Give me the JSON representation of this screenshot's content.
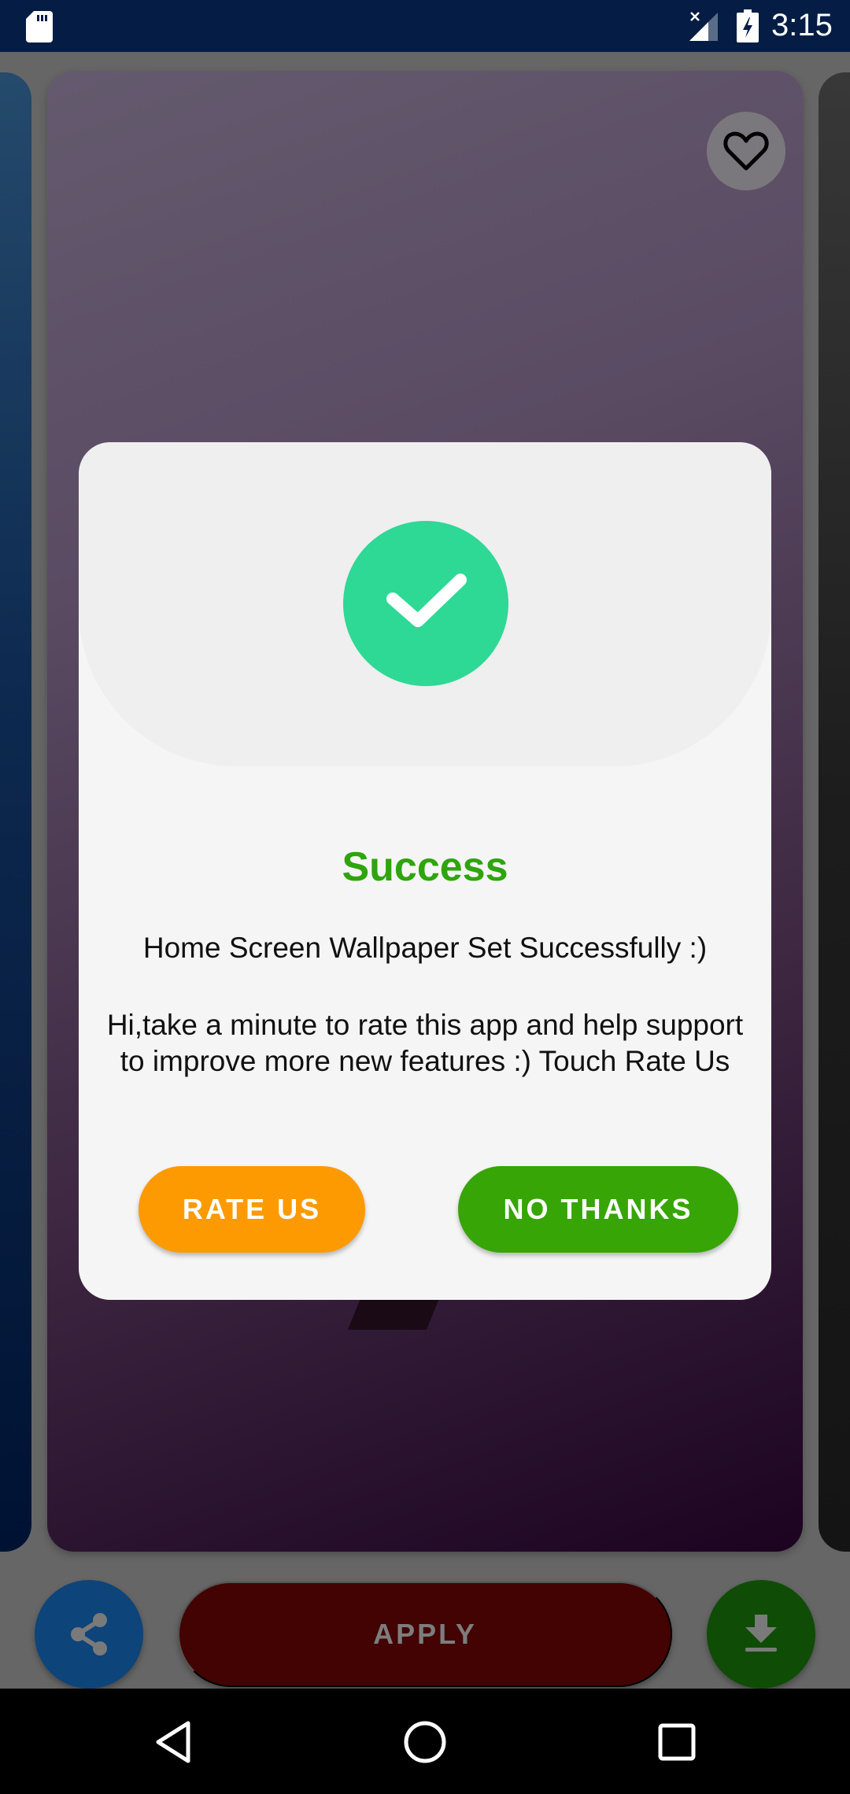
{
  "status_bar": {
    "time": "3:15",
    "icons": [
      "sd-card-icon",
      "signal-no-data-icon",
      "battery-charging-icon"
    ]
  },
  "wallpaper_screen": {
    "favorite_icon": "heart-outline-icon",
    "actions": {
      "share_icon": "share-icon",
      "apply_label": "APPLY",
      "download_icon": "download-icon"
    }
  },
  "dialog": {
    "icon": "check-circle-icon",
    "title": "Success",
    "message": "Home Screen Wallpaper Set Successfully :)",
    "prompt": "Hi,take a minute to rate this app and help support to improve more new features :) Touch Rate Us",
    "rate_button_label": "RATE US",
    "no_thanks_button_label": "NO THANKS",
    "colors": {
      "title": "#2fa40e",
      "badge": "#2ed895",
      "rate_button": "#fd9a02",
      "no_thanks_button": "#36a505"
    }
  },
  "nav_bar": {
    "buttons": [
      "back-icon",
      "home-icon",
      "recents-icon"
    ]
  }
}
